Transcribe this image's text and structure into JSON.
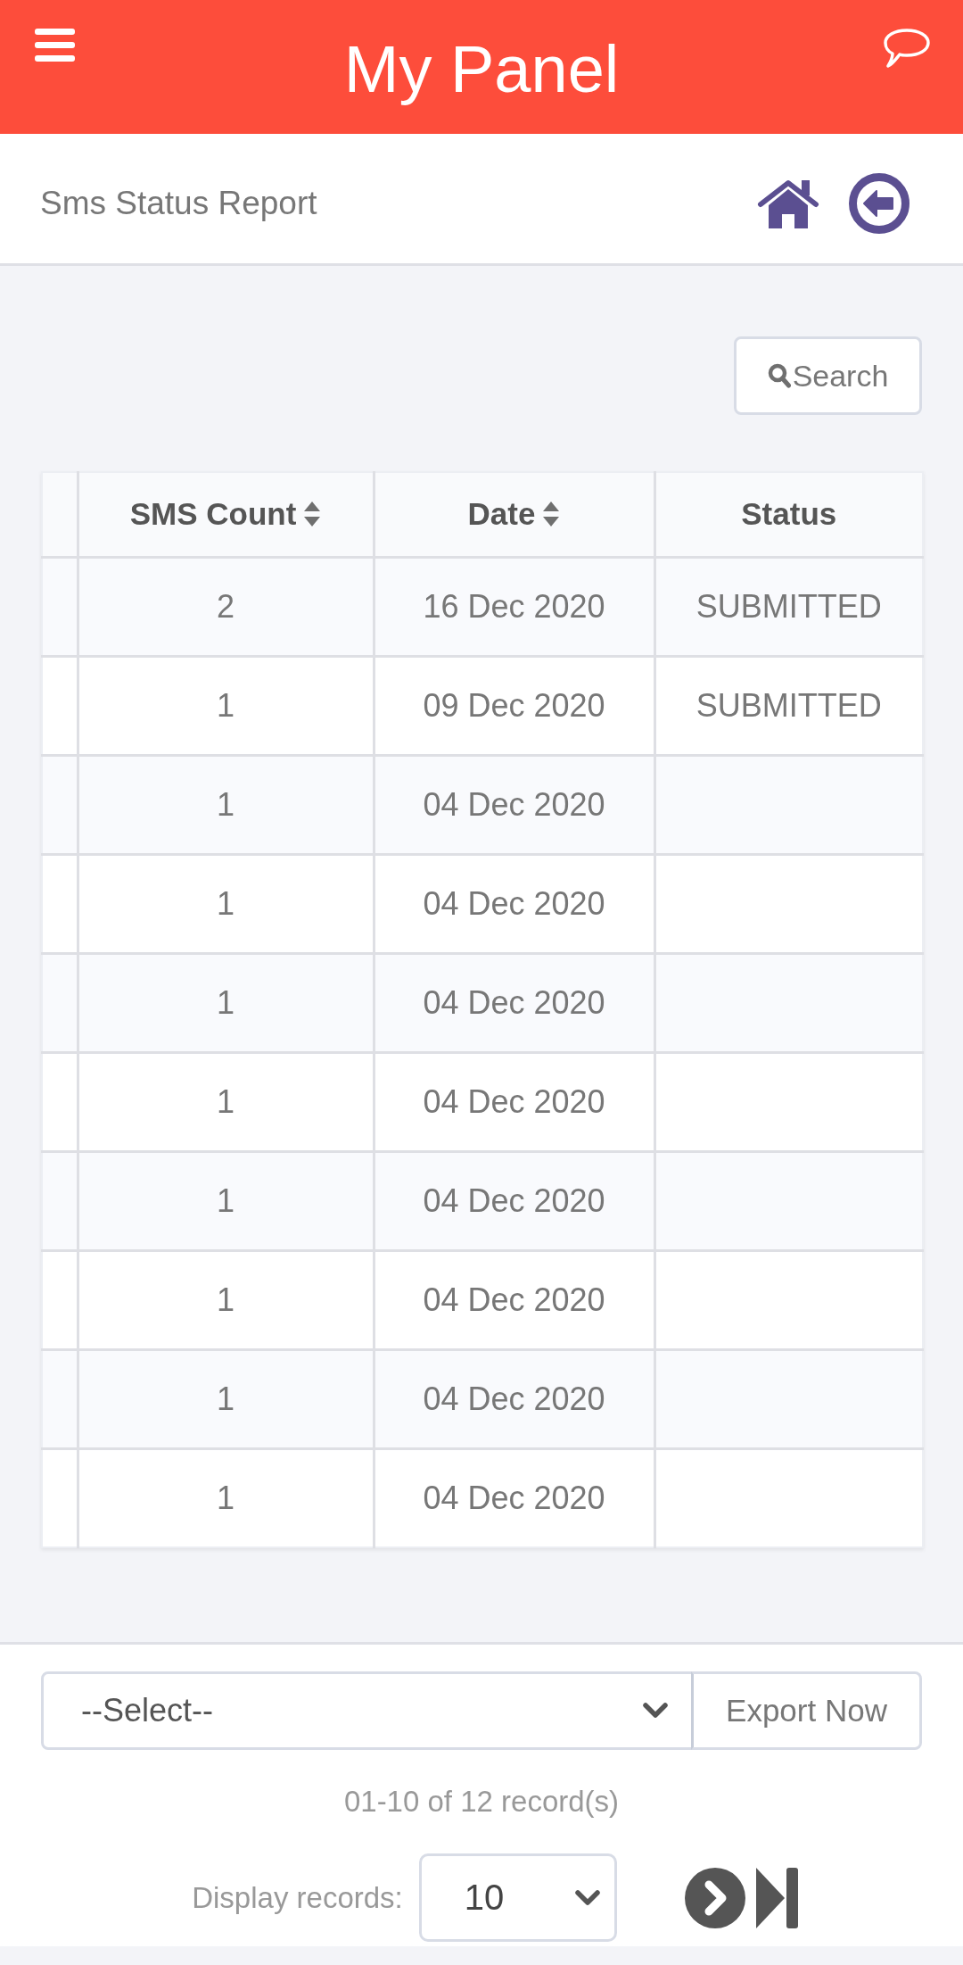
{
  "header": {
    "title": "My Panel"
  },
  "subheader": {
    "title": "Sms Status Report"
  },
  "search_button": {
    "label": "Search"
  },
  "table": {
    "columns": [
      {
        "label": "SMS Count",
        "sortable": true
      },
      {
        "label": "Date",
        "sortable": true
      },
      {
        "label": "Status",
        "sortable": false
      }
    ],
    "rows": [
      {
        "sms_count": "2",
        "date": "16 Dec 2020",
        "status": "SUBMITTED"
      },
      {
        "sms_count": "1",
        "date": "09 Dec 2020",
        "status": "SUBMITTED"
      },
      {
        "sms_count": "1",
        "date": "04 Dec 2020"
      },
      {
        "sms_count": "1",
        "date": "04 Dec 2020"
      },
      {
        "sms_count": "1",
        "date": "04 Dec 2020"
      },
      {
        "sms_count": "1",
        "date": "04 Dec 2020"
      },
      {
        "sms_count": "1",
        "date": "04 Dec 2020"
      },
      {
        "sms_count": "1",
        "date": "04 Dec 2020"
      },
      {
        "sms_count": "1",
        "date": "04 Dec 2020"
      },
      {
        "sms_count": "1",
        "date": "04 Dec 2020"
      }
    ]
  },
  "export": {
    "value": "--Select--",
    "button": "Export Now"
  },
  "pagination": {
    "summary": "01-10 of 12 record(s)",
    "page_size_label": "Display records:",
    "page_size": "10"
  }
}
